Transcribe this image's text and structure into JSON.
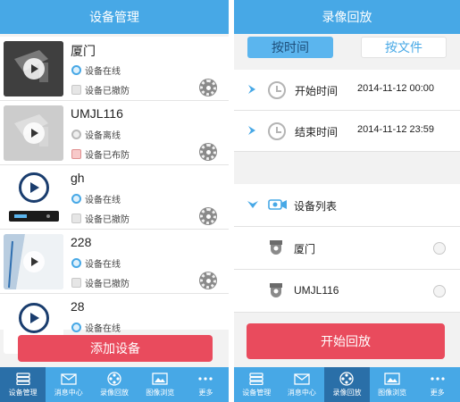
{
  "left": {
    "title": "设备管理",
    "devices": [
      {
        "name": "厦门",
        "net_status": "设备在线",
        "arm_status": "设备已撤防"
      },
      {
        "name": "UMJL116",
        "net_status": "设备离线",
        "arm_status": "设备已布防"
      },
      {
        "name": "gh",
        "net_status": "设备在线",
        "arm_status": "设备已撤防"
      },
      {
        "name": "228",
        "net_status": "设备在线",
        "arm_status": "设备已撤防"
      },
      {
        "name": "28",
        "net_status": "设备在线",
        "arm_status": ""
      }
    ],
    "add_button": "添加设备"
  },
  "right": {
    "title": "录像回放",
    "segments": {
      "by_time": "按时间",
      "by_file": "按文件"
    },
    "start_time_label": "开始时间",
    "start_time_value": "2014-11-12 00:00",
    "end_time_label": "结束时间",
    "end_time_value": "2014-11-12 23:59",
    "device_list_label": "设备列表",
    "devices": [
      "厦门",
      "UMJL116"
    ],
    "start_button": "开始回放"
  },
  "tabbar": {
    "items": [
      "设备管理",
      "消息中心",
      "录像回放",
      "图像浏览",
      "更多"
    ]
  },
  "colors": {
    "header": "#47a8e6",
    "accent_red": "#e94b5d",
    "tab_active": "#2a6fa8"
  }
}
